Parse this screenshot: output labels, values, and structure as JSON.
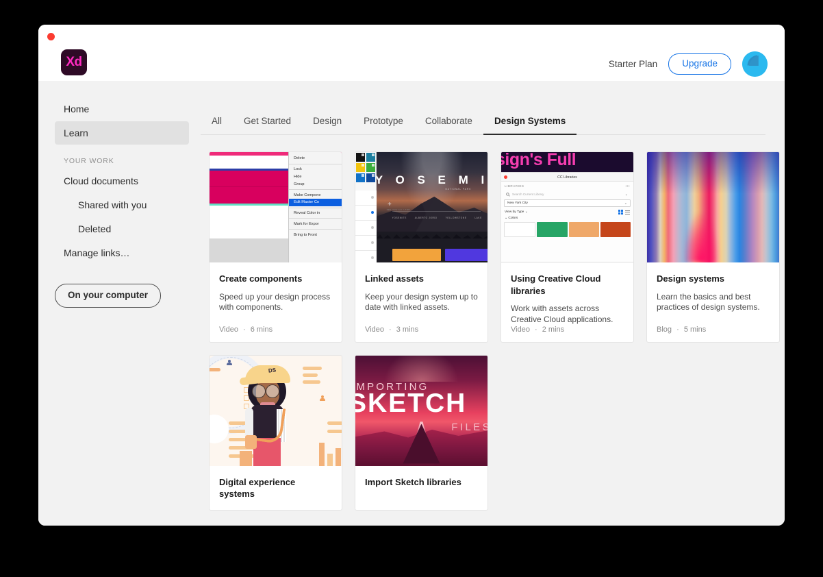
{
  "window": {
    "close_dot_color": "#fb3b30",
    "app_logo_text": "Xd",
    "logo_bg": "#2e0a26",
    "logo_fg": "#ff2bc2"
  },
  "header": {
    "plan_label": "Starter Plan",
    "upgrade_label": "Upgrade",
    "accent_color": "#1473e6",
    "avatar_name": "avatar",
    "avatar_color": "#2bb9ef"
  },
  "sidebar": {
    "items": [
      {
        "label": "Home",
        "level": 0,
        "active": false
      },
      {
        "label": "Learn",
        "level": 0,
        "active": true
      }
    ],
    "section_label": "YOUR WORK",
    "work_items": [
      {
        "label": "Cloud documents",
        "level": 0
      },
      {
        "label": "Shared with you",
        "level": 1
      },
      {
        "label": "Deleted",
        "level": 1
      },
      {
        "label": "Manage links…",
        "level": 0
      }
    ],
    "on_your_computer_label": "On your computer"
  },
  "tabs": [
    {
      "label": "All",
      "active": false
    },
    {
      "label": "Get Started",
      "active": false
    },
    {
      "label": "Design",
      "active": false
    },
    {
      "label": "Prototype",
      "active": false
    },
    {
      "label": "Collaborate",
      "active": false
    },
    {
      "label": "Design Systems",
      "active": true
    }
  ],
  "cards": [
    {
      "title": "Create components",
      "desc": "Speed up your design process with components.",
      "kind": "Video",
      "duration": "6 mins",
      "separator": "·"
    },
    {
      "title": "Linked assets",
      "desc": "Keep your design system up to date with linked assets.",
      "kind": "Video",
      "duration": "3 mins",
      "separator": "·"
    },
    {
      "title": "Using Creative Cloud libraries",
      "desc": "Work with assets across Creative Cloud applications.",
      "kind": "Video",
      "duration": "2 mins",
      "separator": "·"
    },
    {
      "title": "Design systems",
      "desc": "Learn the basics and best practices of design systems.",
      "kind": "Blog",
      "duration": "5 mins",
      "separator": "·"
    },
    {
      "title": "Digital experience systems",
      "desc": "",
      "kind": "",
      "duration": "",
      "separator": ""
    },
    {
      "title": "Import Sketch libraries",
      "desc": "",
      "kind": "",
      "duration": "",
      "separator": ""
    }
  ],
  "thumb1_menu": {
    "items": [
      "Delete",
      "Lock",
      "Hide",
      "Group",
      "Make Compone",
      "Edit Master Co",
      "Reveal Color in",
      "Mark for Expor",
      "Bring to Front"
    ],
    "selected": "Edit Master Co",
    "selected_color": "#0c5fe0",
    "artboard_pink": "#d8005e"
  },
  "thumb2": {
    "title": "Y O S E M I",
    "logo_glyph": "✈",
    "subtitle_text": "NATIONAL PARK",
    "small_label": "SEE YOU ALL LAND",
    "nav": [
      "YOSEMITE",
      "ALBERTO JORDI",
      "YELLOWSTONE",
      "LAKE"
    ],
    "swatches": [
      "#131313",
      "#1d7fa0",
      "#f2c40e",
      "#3cae3c",
      "#1272c7",
      "#0f4b9e"
    ],
    "button_colors": [
      "#f2a33c",
      "#5038df"
    ]
  },
  "thumb3": {
    "banner_text": "sign's Full",
    "panel_title": "CC Libraries",
    "libraries_label": "LIBRARIES",
    "more_glyph": "•••",
    "search_placeholder": "Search Current Library",
    "search_icon": "search-icon",
    "selected_library": "New York City",
    "view_label": "View by Type",
    "colors_label": "Colors",
    "color_swatches": [
      "#ffffff",
      "#27a566",
      "#efa869",
      "#c5461b"
    ]
  },
  "thumb5": {
    "cap_text": "DS"
  },
  "thumb6": {
    "line1": "IMPORTING",
    "line2": "SKETCH",
    "line3": "FILES"
  }
}
